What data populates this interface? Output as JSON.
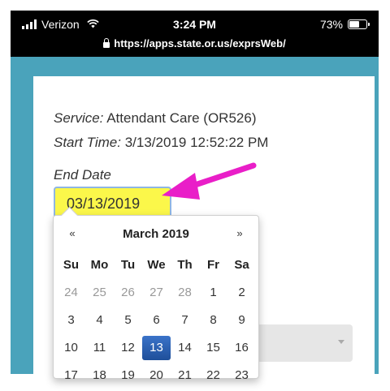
{
  "status_bar": {
    "carrier": "Verizon",
    "time": "3:24 PM",
    "battery": "73%",
    "battery_level": 0.73,
    "url": "https://apps.state.or.us/exprsWeb/"
  },
  "form": {
    "service_label": "Service:",
    "service_value": "Attendant Care (OR526)",
    "start_label": "Start Time:",
    "start_value": "3/13/2019 12:52:22 PM",
    "end_date_label": "End Date",
    "end_date_value": "03/13/2019"
  },
  "calendar": {
    "prev": "«",
    "next": "»",
    "month": "March 2019",
    "weekdays": [
      "Su",
      "Mo",
      "Tu",
      "We",
      "Th",
      "Fr",
      "Sa"
    ],
    "weeks": [
      [
        "24",
        "25",
        "26",
        "27",
        "28",
        "1",
        "2"
      ],
      [
        "3",
        "4",
        "5",
        "6",
        "7",
        "8",
        "9"
      ],
      [
        "10",
        "11",
        "12",
        "13",
        "14",
        "15",
        "16"
      ],
      [
        "17",
        "18",
        "19",
        "20",
        "21",
        "22",
        "23"
      ]
    ],
    "selected": "13"
  },
  "colors": {
    "frame": "#4aa3bb",
    "highlight_input": "#fbf74a",
    "arrow": "#e91ec8",
    "selected_day": "#2a5fb0"
  }
}
